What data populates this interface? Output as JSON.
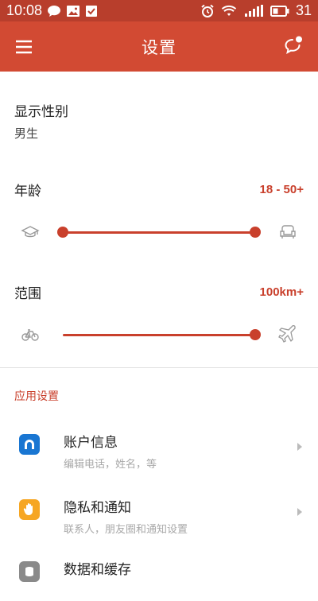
{
  "status_bar": {
    "time": "10:08",
    "battery": "31",
    "icons_left": [
      "chat-bubble-icon",
      "image-icon",
      "check-box-icon"
    ],
    "icons_right": [
      "alarm-icon",
      "wifi-icon",
      "signal-icon",
      "battery-icon"
    ]
  },
  "app_bar": {
    "title": "设置",
    "left_icon": "menu-icon",
    "right_icon": "chat-notify-icon",
    "color": "#d24a33"
  },
  "gender": {
    "label": "显示性别",
    "value": "男生"
  },
  "age": {
    "label": "年龄",
    "value": "18 - 50+",
    "slider_low": 0.0,
    "slider_high": 1.0,
    "icon_left": "graduation-cap-icon",
    "icon_right": "armchair-icon"
  },
  "distance": {
    "label": "范围",
    "value": "100km+",
    "slider_value": 1.0,
    "icon_left": "bicycle-icon",
    "icon_right": "airplane-icon"
  },
  "app_settings": {
    "header": "应用设置",
    "items": [
      {
        "title": "账户信息",
        "subtitle": "编辑电话，姓名，等",
        "icon": "account-icon",
        "color": "#1976d2"
      },
      {
        "title": "隐私和通知",
        "subtitle": "联系人，朋友圈和通知设置",
        "icon": "hand-icon",
        "color": "#f6a623"
      },
      {
        "title": "数据和缓存",
        "subtitle": "",
        "icon": "data-icon",
        "color": "#8a8a8a"
      }
    ]
  },
  "accent": "#c9402c"
}
